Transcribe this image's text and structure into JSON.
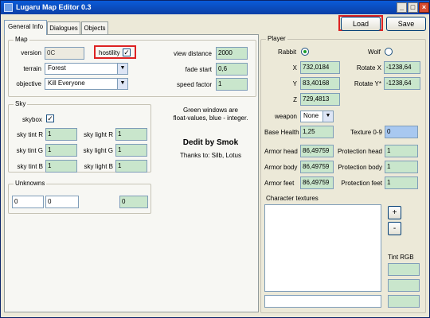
{
  "window": {
    "title": "Lugaru Map Editor 0.3",
    "min": "_",
    "max": "□",
    "close": "×"
  },
  "tabs": [
    "General Info",
    "Dialogues",
    "Objects"
  ],
  "toolbar": {
    "load": "Load",
    "save": "Save"
  },
  "map": {
    "group_title": "Map",
    "version_label": "version",
    "version_value": "0C",
    "hostility_label": "hostility",
    "hostility_checked": "✓",
    "terrain_label": "terrain",
    "terrain_value": "Forest",
    "objective_label": "objective",
    "objective_value": "Kill Everyone",
    "view_distance_label": "view distance",
    "view_distance_value": "2000",
    "fade_start_label": "fade start",
    "fade_start_value": "0,6",
    "speed_factor_label": "speed factor",
    "speed_factor_value": "1"
  },
  "sky": {
    "group_title": "Sky",
    "skybox_label": "skybox",
    "skybox_checked": "✓",
    "tint_r_label": "sky tint R",
    "tint_r_value": "1",
    "tint_g_label": "sky tint G",
    "tint_g_value": "1",
    "tint_b_label": "sky tint B",
    "tint_b_value": "1",
    "light_r_label": "sky light R",
    "light_r_value": "1",
    "light_g_label": "sky light G",
    "light_g_value": "1",
    "light_b_label": "sky light B",
    "light_b_value": "1"
  },
  "info": {
    "note_line1": "Green windows are",
    "note_line2": "float-values, blue - integer.",
    "credit": "Dedit by Smok",
    "thanks": "Thanks to: Silb, Lotus"
  },
  "unknowns": {
    "group_title": "Unknowns",
    "value1": "0",
    "value2": "0",
    "value3": "0"
  },
  "player": {
    "group_title": "Player",
    "rabbit_label": "Rabbit",
    "wolf_label": "Wolf",
    "x_label": "X",
    "x_value": "732,0184",
    "y_label": "Y",
    "y_value": "83,40168",
    "z_label": "Z",
    "z_value": "729,4813",
    "rotate_x_label": "Rotate X",
    "rotate_x_value": "-1238,64",
    "rotate_y_label": "Rotate Y*",
    "rotate_y_value": "-1238,64",
    "weapon_label": "weapon",
    "weapon_value": "None",
    "base_health_label": "Base Health",
    "base_health_value": "1,25",
    "texture_label": "Texture 0-9",
    "texture_value": "0",
    "armor_head_label": "Armor head",
    "armor_head_value": "86,49759",
    "armor_body_label": "Armor body",
    "armor_body_value": "86,49759",
    "armor_feet_label": "Armor feet",
    "armor_feet_value": "86,49759",
    "prot_head_label": "Protection head",
    "prot_head_value": "1",
    "prot_body_label": "Protection body",
    "prot_body_value": "1",
    "prot_feet_label": "Protection feet",
    "prot_feet_value": "1",
    "char_textures_label": "Character textures",
    "add_label": "+",
    "remove_label": "-",
    "tint_rgb_label": "Tint RGB"
  },
  "colors": {
    "float_field": "#c9e6cc",
    "int_field": "#a8c8f0",
    "highlight": "#dd2222",
    "titlebar": "#0a5bd8"
  }
}
